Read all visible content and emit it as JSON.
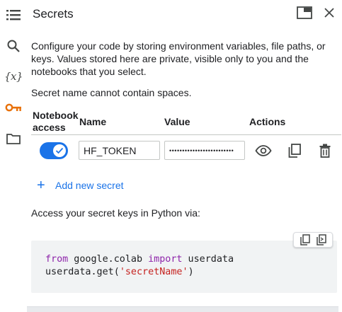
{
  "panel": {
    "title": "Secrets",
    "description": "Configure your code by storing environment variables, file paths, or keys. Values stored here are private, visible only to you and the notebooks that you select.",
    "name_note": "Secret name cannot contain spaces."
  },
  "rail": {
    "items": [
      {
        "icon": "list-icon"
      },
      {
        "icon": "search-icon"
      },
      {
        "icon": "variables-icon",
        "glyph": "{x}"
      },
      {
        "icon": "key-icon",
        "active": true
      },
      {
        "icon": "folder-icon"
      }
    ]
  },
  "table": {
    "headers": {
      "notebook_access": "Notebook access",
      "name": "Name",
      "value": "Value",
      "actions": "Actions"
    },
    "rows": [
      {
        "notebook_access": true,
        "name": "HF_TOKEN",
        "value": "•••••••••••••••••••••••••"
      }
    ]
  },
  "add_secret_label": "Add new secret",
  "access_text": "Access your secret keys in Python via:",
  "code": {
    "line1": {
      "kw1": "from",
      "mod": " google.colab ",
      "kw2": "import",
      "name": " userdata"
    },
    "line2": {
      "prefix": "userdata.get(",
      "str": "'secretName'",
      "suffix": ")"
    }
  },
  "colors": {
    "accent": "#1a73e8",
    "key_icon": "#e8710a",
    "keyword": "#8e24aa",
    "string": "#c5221f"
  }
}
